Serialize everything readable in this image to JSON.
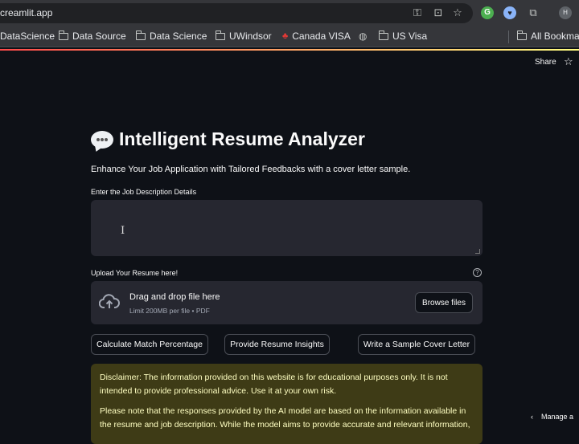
{
  "browser": {
    "url": "creamlit.app",
    "toolbar_icons": [
      "key-icon",
      "install-icon",
      "bookmark-star-icon",
      "grammarly-icon",
      "shield-extension-icon",
      "extensions-puzzle-icon",
      "profile-avatar"
    ],
    "profile_initial": "H",
    "bookmarks": [
      {
        "label": "DataScience",
        "icon": "folder-icon"
      },
      {
        "label": "Data Source",
        "icon": "folder-icon"
      },
      {
        "label": "Data Science",
        "icon": "folder-icon"
      },
      {
        "label": "UWindsor",
        "icon": "folder-icon"
      },
      {
        "label": "Canada VISA",
        "icon": "maple-leaf-icon"
      },
      {
        "label": "",
        "icon": "globe-icon"
      },
      {
        "label": "US Visa",
        "icon": "folder-icon"
      },
      {
        "label": "All Bookma",
        "icon": "folder-icon"
      }
    ]
  },
  "header": {
    "share_label": "Share",
    "star_icon": "star-icon"
  },
  "main": {
    "title_icon": "speech-balloon-icon",
    "title": "Intelligent Resume Analyzer",
    "subtitle": "Enhance Your Job Application with Tailored Feedbacks with a cover letter sample.",
    "job_description": {
      "label": "Enter the Job Description Details",
      "value": ""
    },
    "upload": {
      "label": "Upload Your Resume here!",
      "help_icon": "question-circle-icon",
      "drop_title": "Drag and drop file here",
      "drop_subtitle": "Limit 200MB per file • PDF",
      "browse_label": "Browse files"
    },
    "actions": [
      {
        "label": "Calculate Match Percentage"
      },
      {
        "label": "Provide Resume Insights"
      },
      {
        "label": "Write a Sample Cover Letter"
      }
    ],
    "disclaimer": {
      "paragraph1": "Disclaimer: The information provided on this website is for educational purposes only. It is not intended to provide professional advice. Use it at your own risk.",
      "paragraph2": "Please note that the responses provided by the AI model are based on the information available in the resume and job description. While the model aims to provide accurate and relevant information,"
    }
  },
  "footer": {
    "manage_label": "Manage a"
  },
  "colors": {
    "background": "#0e1117",
    "input_bg": "#262730",
    "warning_bg": "#3e3b16",
    "warning_text": "#ffffc2"
  }
}
